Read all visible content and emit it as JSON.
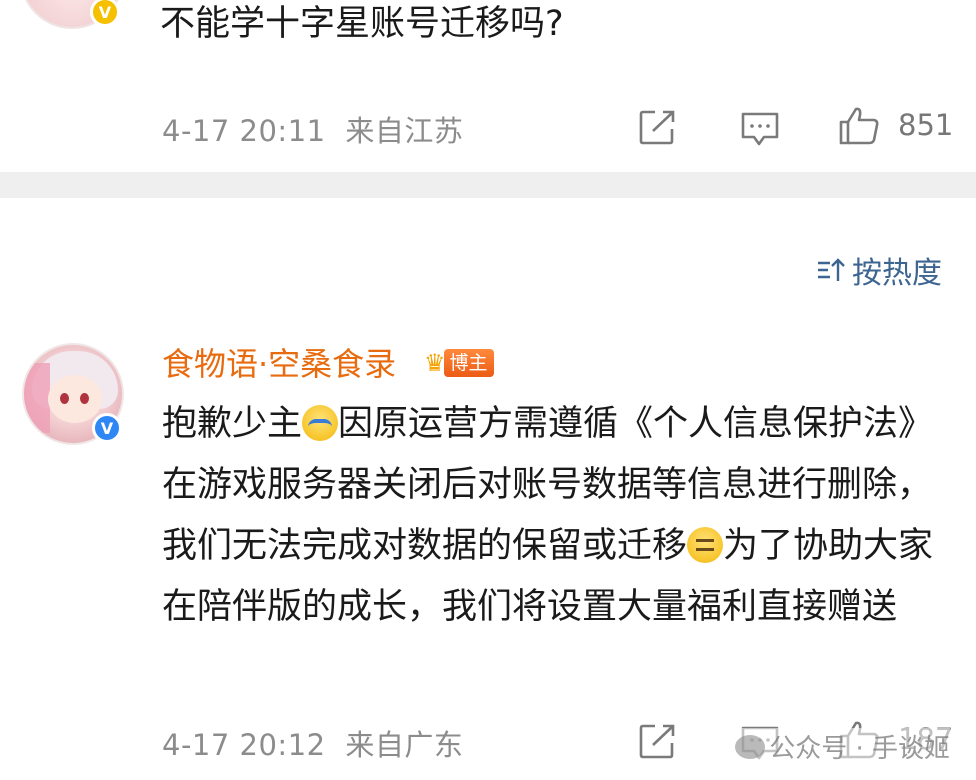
{
  "top_comment": {
    "text": "不能学十字星账号迁移吗?",
    "timestamp": "4-17 20:11",
    "location": "来自江苏",
    "like_count": "851",
    "badge": "V"
  },
  "sort": {
    "label": "按热度",
    "icon": "sort-icon"
  },
  "comment2": {
    "username": "食物语·空桑食录",
    "role_badge": "博主",
    "verified_badge": "V",
    "text_part1": "抱歉少主",
    "text_part2": "因原运营方需遵循《个人信息保护法》在游戏服务器关闭后对账号数据等信息进行删除，我们无法完成对数据的保留或迁移",
    "text_part3": "为了协助大家在陪伴版的成长，我们将设置大量福利直接赠送",
    "timestamp": "4-17 20:12",
    "location": "来自广东",
    "like_count": "187"
  },
  "watermark": {
    "text": "公众号 · 手谈姬"
  },
  "icons": {
    "share": "share-icon",
    "comment": "comment-icon",
    "like": "like-icon"
  },
  "colors": {
    "username": "#e86b0f",
    "sort_link": "#3d6591",
    "meta_gray": "#8c8c8c",
    "divider": "#efefef"
  }
}
